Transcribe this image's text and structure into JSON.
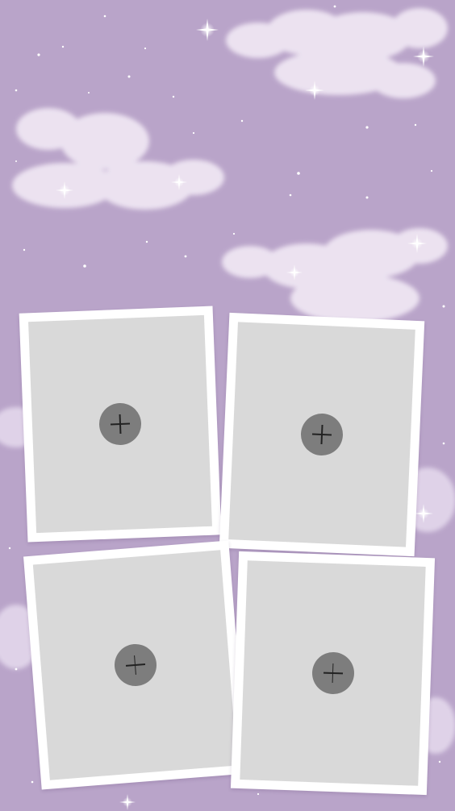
{
  "background": {
    "color": "#b9a4c9",
    "decorations": [
      "cloud",
      "sparkle"
    ]
  },
  "frames": [
    {
      "slot_color": "#d9d9d9",
      "border_color": "#ffffff",
      "button_icon": "plus-icon",
      "button_color": "#7d7d7d"
    },
    {
      "slot_color": "#d9d9d9",
      "border_color": "#ffffff",
      "button_icon": "plus-icon",
      "button_color": "#7d7d7d"
    },
    {
      "slot_color": "#d9d9d9",
      "border_color": "#ffffff",
      "button_icon": "plus-icon",
      "button_color": "#7d7d7d"
    },
    {
      "slot_color": "#d9d9d9",
      "border_color": "#ffffff",
      "button_icon": "plus-icon",
      "button_color": "#7d7d7d"
    }
  ]
}
